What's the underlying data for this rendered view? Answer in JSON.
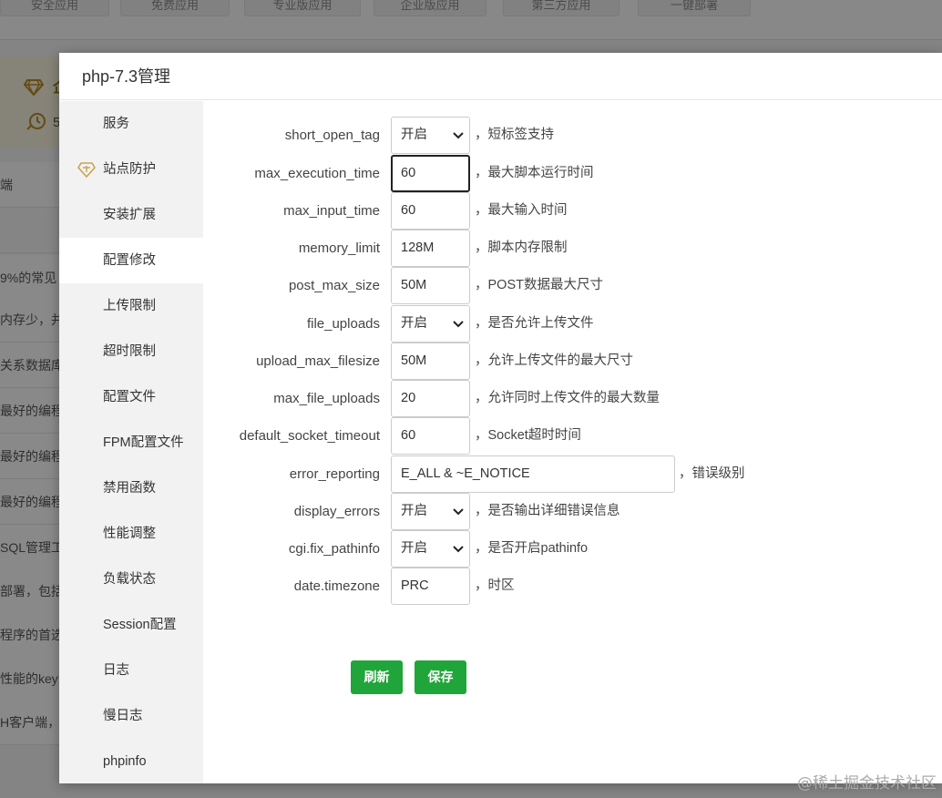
{
  "background": {
    "tabs": [
      "安全应用",
      "免费应用",
      "专业版应用",
      "企业版应用",
      "第三方应用",
      "一键部署"
    ],
    "card_title": "企",
    "card_subtitle": "5",
    "rows": [
      "端",
      "",
      "9%的常见",
      "内存少，并",
      "关系数据库",
      "最好的编程",
      "最好的编程",
      "最好的编程",
      "SQL管理工",
      "部署，包括",
      "程序的首选",
      "性能的key",
      "H客户端，"
    ]
  },
  "modal": {
    "title": "php-7.3管理",
    "sidebar": [
      {
        "label": "服务",
        "icon": ""
      },
      {
        "label": "站点防护",
        "icon": "shield-diamond-icon"
      },
      {
        "label": "安装扩展",
        "icon": ""
      },
      {
        "label": "配置修改",
        "icon": "",
        "active": true
      },
      {
        "label": "上传限制",
        "icon": ""
      },
      {
        "label": "超时限制",
        "icon": ""
      },
      {
        "label": "配置文件",
        "icon": ""
      },
      {
        "label": "FPM配置文件",
        "icon": ""
      },
      {
        "label": "禁用函数",
        "icon": ""
      },
      {
        "label": "性能调整",
        "icon": ""
      },
      {
        "label": "负载状态",
        "icon": ""
      },
      {
        "label": "Session配置",
        "icon": ""
      },
      {
        "label": "日志",
        "icon": ""
      },
      {
        "label": "慢日志",
        "icon": ""
      },
      {
        "label": "phpinfo",
        "icon": ""
      }
    ],
    "fields": [
      {
        "name": "short_open_tag",
        "type": "select",
        "value": "开启",
        "note": "，短标签支持"
      },
      {
        "name": "max_execution_time",
        "type": "input",
        "value": "60",
        "note": "，最大脚本运行时间",
        "focused": true
      },
      {
        "name": "max_input_time",
        "type": "input",
        "value": "60",
        "note": "，最大输入时间"
      },
      {
        "name": "memory_limit",
        "type": "input",
        "value": "128M",
        "note": "，脚本内存限制"
      },
      {
        "name": "post_max_size",
        "type": "input",
        "value": "50M",
        "note": "，POST数据最大尺寸"
      },
      {
        "name": "file_uploads",
        "type": "select",
        "value": "开启",
        "note": "，是否允许上传文件"
      },
      {
        "name": "upload_max_filesize",
        "type": "input",
        "value": "50M",
        "note": "，允许上传文件的最大尺寸"
      },
      {
        "name": "max_file_uploads",
        "type": "input",
        "value": "20",
        "note": "，允许同时上传文件的最大数量"
      },
      {
        "name": "default_socket_timeout",
        "type": "input",
        "value": "60",
        "note": "，Socket超时时间"
      },
      {
        "name": "error_reporting",
        "type": "input",
        "value": "E_ALL & ~E_NOTICE",
        "note": "，错误级别",
        "wide": true
      },
      {
        "name": "display_errors",
        "type": "select",
        "value": "开启",
        "note": "，是否输出详细错误信息"
      },
      {
        "name": "cgi.fix_pathinfo",
        "type": "select",
        "value": "开启",
        "note": "，是否开启pathinfo"
      },
      {
        "name": "date.timezone",
        "type": "input",
        "value": "PRC",
        "note": "，时区"
      }
    ],
    "buttons": {
      "refresh": "刷新",
      "save": "保存"
    },
    "accent_color": "#20a53a"
  },
  "watermark": "@稀土掘金技术社区"
}
